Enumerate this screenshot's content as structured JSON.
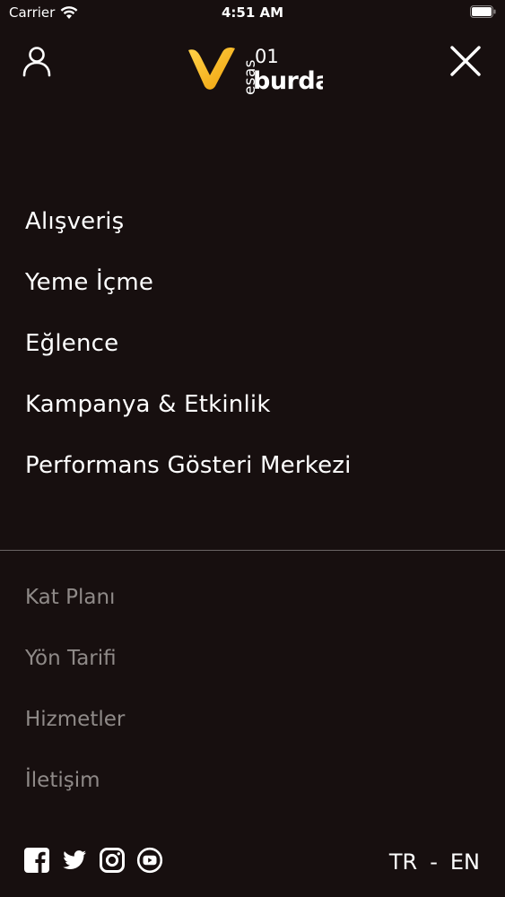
{
  "status_bar": {
    "carrier": "Carrier",
    "time": "4:51 AM"
  },
  "header": {
    "user_icon": "user-icon",
    "close_icon": "close-icon",
    "logo": {
      "brand_small": "esas",
      "brand_number": "01",
      "brand_main": "burda"
    }
  },
  "primary_menu": {
    "items": [
      {
        "label": "Alışveriş"
      },
      {
        "label": "Yeme İçme"
      },
      {
        "label": "Eğlence"
      },
      {
        "label": "Kampanya & Etkinlik"
      },
      {
        "label": "Performans Gösteri Merkezi"
      }
    ]
  },
  "secondary_menu": {
    "items": [
      {
        "label": "Kat Planı"
      },
      {
        "label": "Yön Tarifi"
      },
      {
        "label": "Hizmetler"
      },
      {
        "label": "İletişim"
      }
    ]
  },
  "social": {
    "icons": [
      "facebook-icon",
      "twitter-icon",
      "instagram-icon",
      "youtube-icon"
    ]
  },
  "language": {
    "tr": "TR",
    "separator": "-",
    "en": "EN"
  },
  "colors": {
    "background": "#170f0f",
    "primary_text": "#ffffff",
    "secondary_text": "#8f8a88",
    "logo_yellow": "#f6b81c"
  }
}
